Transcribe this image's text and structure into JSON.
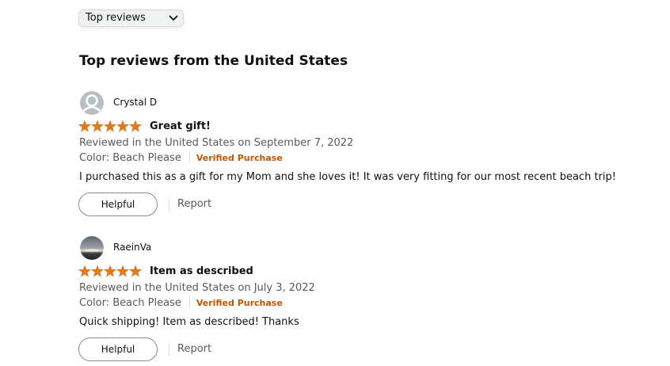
{
  "sort": {
    "selected": "Top reviews",
    "icon": "chevron-down-icon"
  },
  "section": {
    "title": "Top reviews from the United States"
  },
  "colors": {
    "star": "#de7921",
    "verified": "#c45500",
    "muted": "#565959"
  },
  "reviews": [
    {
      "author": "Crystal D",
      "avatar": "default-user-avatar",
      "rating": 5,
      "rating_max": 5,
      "title": "Great gift!",
      "date": "Reviewed in the United States on September 7, 2022",
      "variant": "Color: Beach Please",
      "verified": "Verified Purchase",
      "body": "I purchased this as a gift for my Mom and she loves it! It was very fitting for our most recent beach trip!",
      "helpful_label": "Helpful",
      "report_label": "Report"
    },
    {
      "author": "RaeinVa",
      "avatar": "sunset-photo-avatar",
      "rating": 5,
      "rating_max": 5,
      "title": "Item as described",
      "date": "Reviewed in the United States on July 3, 2022",
      "variant": "Color: Beach Please",
      "verified": "Verified Purchase",
      "body": "Quick shipping! Item as described! Thanks",
      "helpful_label": "Helpful",
      "report_label": "Report"
    }
  ]
}
